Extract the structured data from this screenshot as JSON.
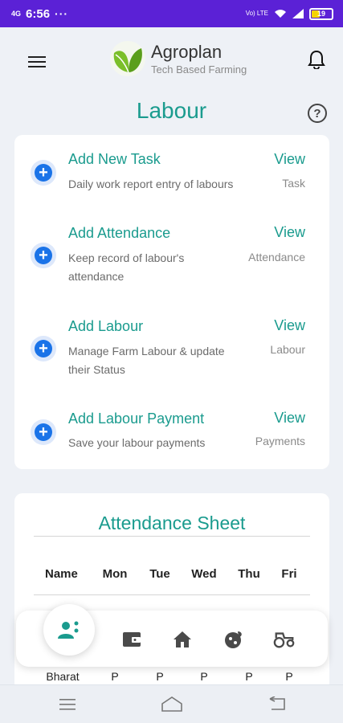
{
  "status_bar": {
    "network": "4G",
    "time": "6:56",
    "dots": "···",
    "volte": "Vo) LTE",
    "battery": "19"
  },
  "header": {
    "app_name": "Agroplan",
    "tagline": "Tech Based Farming",
    "icons": [
      "menu-icon",
      "logo-icon",
      "bell-icon"
    ]
  },
  "page": {
    "title": "Labour",
    "help": "?"
  },
  "actions": [
    {
      "title": "Add New Task",
      "desc": "Daily work report entry of labours",
      "view": "View",
      "sub": "Task"
    },
    {
      "title": "Add Attendance",
      "desc": "Keep record of labour's attendance",
      "view": "View",
      "sub": "Attendance"
    },
    {
      "title": "Add Labour",
      "desc": "Manage Farm Labour & update their Status",
      "view": "View",
      "sub": "Labour"
    },
    {
      "title": "Add Labour Payment",
      "desc": "Save your labour payments",
      "view": "View",
      "sub": "Payments"
    }
  ],
  "attendance": {
    "title": "Attendance Sheet",
    "columns": [
      "Name",
      "Mon",
      "Tue",
      "Wed",
      "Thu",
      "Fri"
    ],
    "row": [
      "Bharat",
      "P",
      "P",
      "P",
      "P",
      "P"
    ]
  },
  "bottom_nav": {
    "items": [
      "labour-icon",
      "wallet-icon",
      "home-icon",
      "crop-icon",
      "tractor-icon"
    ],
    "active": "labour-icon"
  },
  "colors": {
    "accent": "#1a9b8e",
    "status_bar": "#5b21d6",
    "plus": "#1a73e8"
  }
}
